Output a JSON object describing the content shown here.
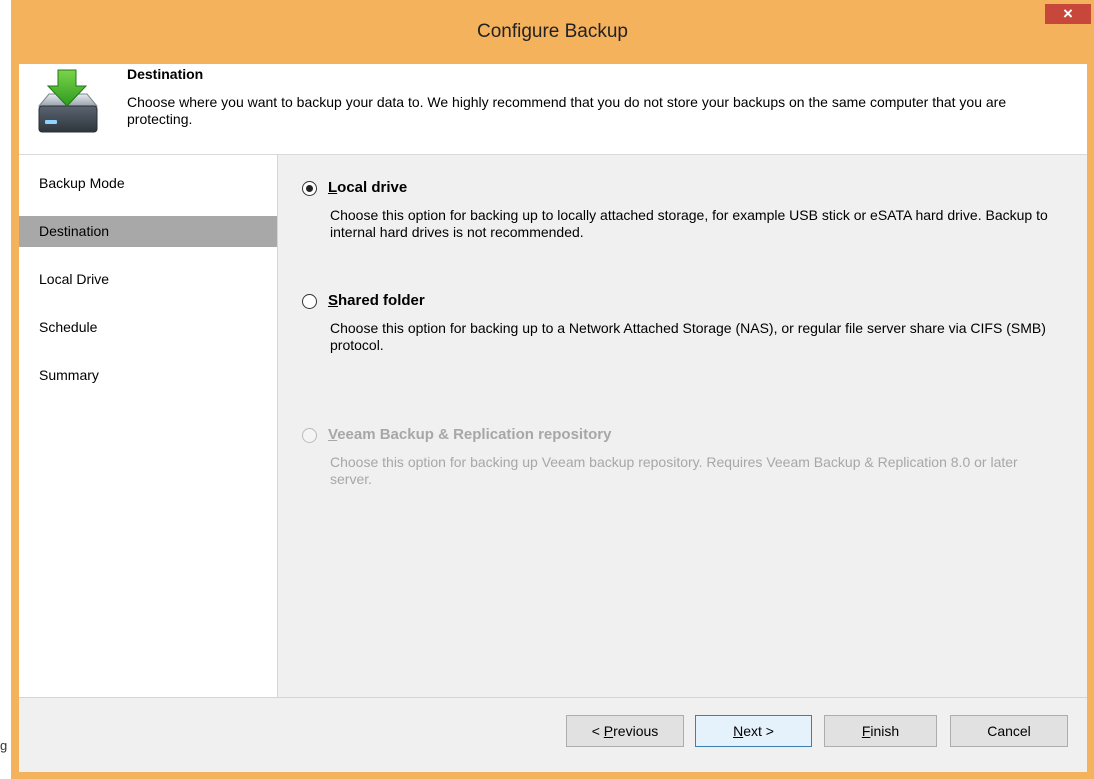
{
  "background": {
    "partial_text": "g"
  },
  "window": {
    "title": "Configure Backup",
    "close_glyph": "×"
  },
  "header": {
    "title": "Destination",
    "description": "Choose where you want to backup your data to. We highly recommend that you do not store your backups on the same computer that you are protecting.",
    "icon": "drive-download-icon"
  },
  "sidebar": {
    "items": [
      {
        "label": "Backup Mode",
        "selected": false
      },
      {
        "label": "Destination",
        "selected": true
      },
      {
        "label": "Local Drive",
        "selected": false
      },
      {
        "label": "Schedule",
        "selected": false
      },
      {
        "label": "Summary",
        "selected": false
      }
    ]
  },
  "options": [
    {
      "label_accel": "L",
      "label_rest": "ocal drive",
      "description": "Choose this option for backing up to locally attached storage, for example USB stick or eSATA hard drive. Backup to internal hard drives is not recommended.",
      "checked": true,
      "enabled": true
    },
    {
      "label_accel": "S",
      "label_rest": "hared folder",
      "description": "Choose this option for backing up to a Network Attached Storage (NAS), or regular file server share via CIFS (SMB) protocol.",
      "checked": false,
      "enabled": true
    },
    {
      "label_accel": "V",
      "label_rest": "eeam Backup & Replication repository",
      "description": "Choose this option for backing up Veeam backup repository. Requires Veeam Backup & Replication 8.0 or later server.",
      "checked": false,
      "enabled": false
    }
  ],
  "buttons": {
    "previous": {
      "pre": "< ",
      "accel": "P",
      "post": "revious"
    },
    "next": {
      "pre": "",
      "accel": "N",
      "post": "ext >"
    },
    "finish": {
      "pre": "",
      "accel": "F",
      "post": "inish"
    },
    "cancel": {
      "label": "Cancel"
    }
  },
  "colors": {
    "titlebar": "#f5b25c",
    "close": "#c7473b",
    "selected_nav": "#a8a8a8",
    "disabled_text": "#a7a7a7"
  }
}
